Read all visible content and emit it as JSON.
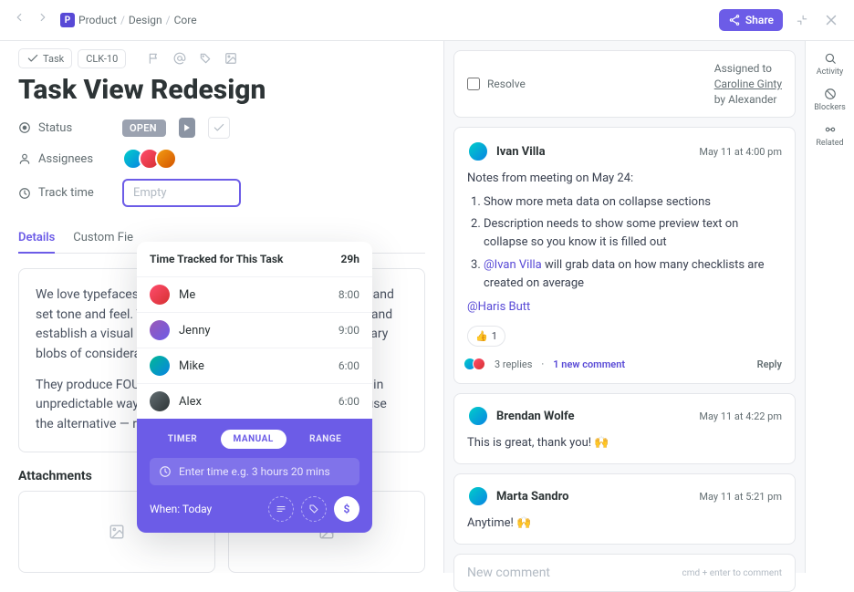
{
  "breadcrumbs": {
    "root": "P",
    "items": [
      "Product",
      "Design",
      "Core"
    ]
  },
  "topbar": {
    "share": "Share"
  },
  "pills": {
    "task": "Task",
    "id": "CLK-10"
  },
  "title": "Task View Redesign",
  "meta": {
    "status_label": "Status",
    "status_value": "OPEN",
    "assignees_label": "Assignees",
    "track_label": "Track time",
    "track_value": "Empty"
  },
  "tabs": [
    "Details",
    "Custom Fie"
  ],
  "body": {
    "p1": "We love typefaces. They give text character, make it legible, and set tone and feel. They convey the inform-content of words and establish a visual information hierarchy. But they're also binary blobs of considerable size that can make sites slow.",
    "p2": "They produce FOUT, FOIT, and FOFT and interrupt rendering in unpredictable ways. Why should we put up with that? Because the alternative — relying on the"
  },
  "attachments": {
    "header": "Attachments"
  },
  "popover": {
    "title": "Time Tracked for This Task",
    "total": "29h",
    "rows": [
      {
        "name": "Me",
        "time": "8:00"
      },
      {
        "name": "Jenny",
        "time": "9:00"
      },
      {
        "name": "Mike",
        "time": "6:00"
      },
      {
        "name": "Alex",
        "time": "6:00"
      }
    ],
    "seg": [
      "TIMER",
      "MANUAL",
      "RANGE"
    ],
    "placeholder": "Enter time e.g. 3 hours 20 mins",
    "when": "When: Today"
  },
  "assignbar": {
    "resolve": "Resolve",
    "assigned_to_prefix": "Assigned to ",
    "assignee": "Caroline Ginty",
    "by": " by Alexander"
  },
  "comments": [
    {
      "author": "Ivan Villa",
      "time": "May 11 at 4:00 pm",
      "intro": "Notes from meeting on May 24:",
      "items": [
        "Show more meta data on collapse sections",
        "Description needs to show some preview text on collapse so you know it is filled out"
      ],
      "item3_mention": "@Ivan Villa",
      "item3_rest": " will grab data on how many checklists are created on average",
      "tail_mention": "@Haris Butt",
      "react": "👍",
      "react_count": "1",
      "replies": "3 replies",
      "newc": "1 new comment",
      "reply": "Reply"
    },
    {
      "author": "Brendan Wolfe",
      "time": "May 11 at 4:22 pm",
      "text": "This is great, thank you! 🙌"
    },
    {
      "author": "Marta Sandro",
      "time": "May 11 at 5:21 pm",
      "text": "Anytime! 🙌"
    }
  ],
  "commentbox": {
    "placeholder": "New comment",
    "hint": "cmd + enter to comment"
  },
  "rail": [
    {
      "label": "Activity"
    },
    {
      "label": "Blockers"
    },
    {
      "label": "Related"
    }
  ]
}
